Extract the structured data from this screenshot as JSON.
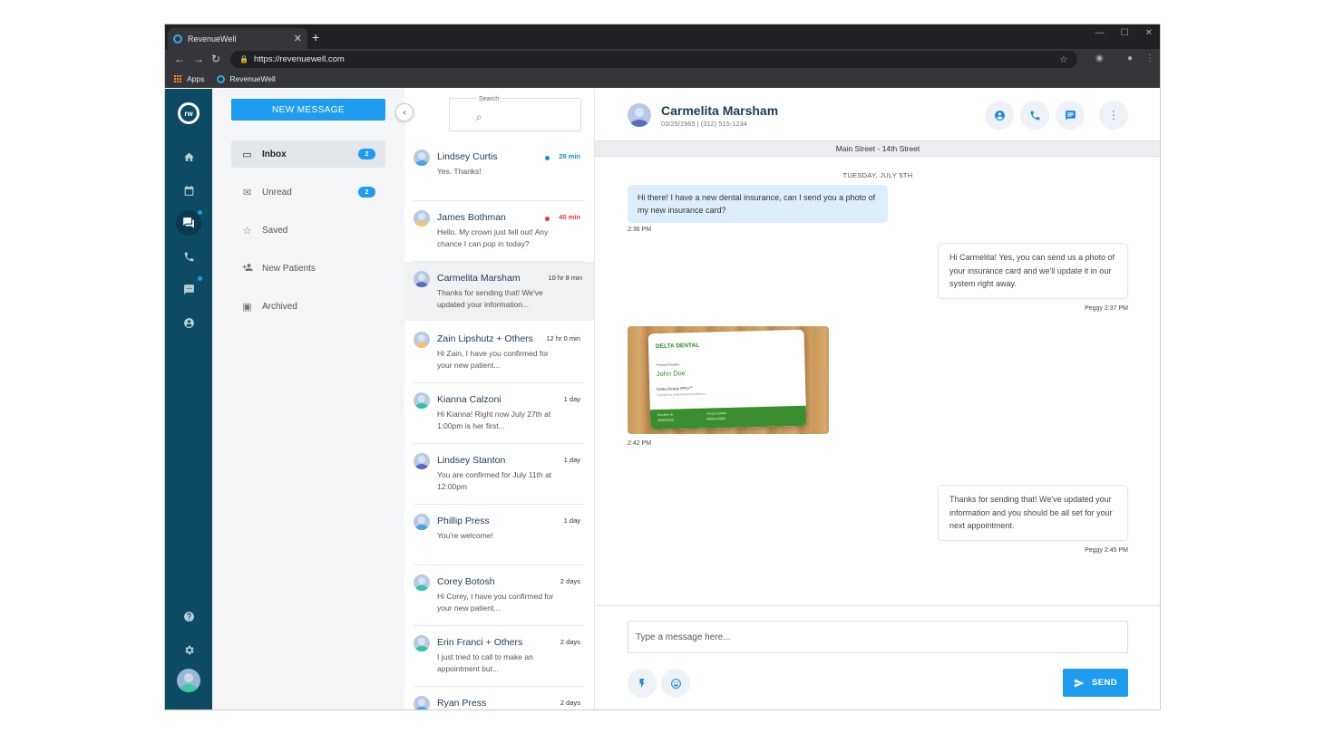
{
  "browser": {
    "tab_title": "RevenueWell",
    "new_tab": "+",
    "url": "https://revenuewell.com",
    "bookmarks": [
      "Apps",
      "RevenueWell"
    ]
  },
  "nav": {
    "logo": "rw",
    "icons": [
      "home-icon",
      "calendar-icon",
      "chat-icon",
      "phone-icon",
      "sms-icon",
      "account-icon",
      "help-icon",
      "gear-icon"
    ]
  },
  "folders": {
    "new_message": "NEW MESSAGE",
    "items": [
      {
        "label": "Inbox",
        "count": "2"
      },
      {
        "label": "Unread",
        "count": "2"
      },
      {
        "label": "Saved"
      },
      {
        "label": "New Patients"
      },
      {
        "label": "Archived"
      }
    ]
  },
  "search": {
    "label": "Search",
    "placeholder": ""
  },
  "conversations": [
    {
      "name": "Lindsey Curtis",
      "time": "28 min",
      "preview": "Yes. Thanks!"
    },
    {
      "name": "James Bothman",
      "time": "45 min",
      "preview": "Hello. My crown just fell out! Any chance I can pop in today?"
    },
    {
      "name": "Carmelita Marsham",
      "time": "10 hr 8 min",
      "preview": "Thanks for sending that! We've updated your information..."
    },
    {
      "name": "Zain Lipshutz + Others",
      "time": "12 hr 0 min",
      "preview": "Hi Zain, I have you confirmed for your new patient..."
    },
    {
      "name": "Kianna Calzoni",
      "time": "1 day",
      "preview": "Hi Kianna! Right now July 27th at 1:00pm is her first..."
    },
    {
      "name": "Lindsey Stanton",
      "time": "1 day",
      "preview": "You are confirmed for July 11th at 12:00pm"
    },
    {
      "name": "Phillip Press",
      "time": "1 day",
      "preview": "You're welcome!"
    },
    {
      "name": "Corey Botosh",
      "time": "2 days",
      "preview": "Hi Corey, I have you confirmed for your new patient..."
    },
    {
      "name": "Erin Franci + Others",
      "time": "2 days",
      "preview": "I just tried to call to make an appointment but..."
    },
    {
      "name": "Ryan Press",
      "time": "2 days",
      "preview": ""
    }
  ],
  "chat": {
    "patient_name": "Carmelita Marsham",
    "patient_info": "03/25/1965   |   (312) 515-1234",
    "location": "Main Street - 14th Street",
    "date": "TUESDAY, JULY 5TH",
    "messages": [
      {
        "text": "Hi there! I have a new dental insurance, can I send you a photo of my new insurance card?",
        "time": "2:36 PM"
      },
      {
        "text": "Hi Carmelita! Yes, you can send us a photo of your insurance card and we'll update it in our system right away.",
        "time": "Peggy 2:37 PM"
      },
      {
        "time": "2:42 PM"
      },
      {
        "text": "Thanks for sending that! We've updated your information and you should be all set for your next appointment.",
        "time": "Peggy 2:45 PM"
      }
    ],
    "card": {
      "brand": "DELTA DENTAL",
      "primary": "Primary Enrollee",
      "name": "John Doe",
      "plan": "Delta Dental PPO℠",
      "provided": "Provided by Delta Dental of California",
      "enrollee": "Enrollee ID",
      "enrollee_val": "000000000",
      "group": "Group number",
      "group_val": "00000-00000"
    },
    "composer_placeholder": "Type a message here...",
    "send": "SEND"
  },
  "colors": {
    "accent": "#1e9cf0",
    "nav": "#0d4a63"
  }
}
